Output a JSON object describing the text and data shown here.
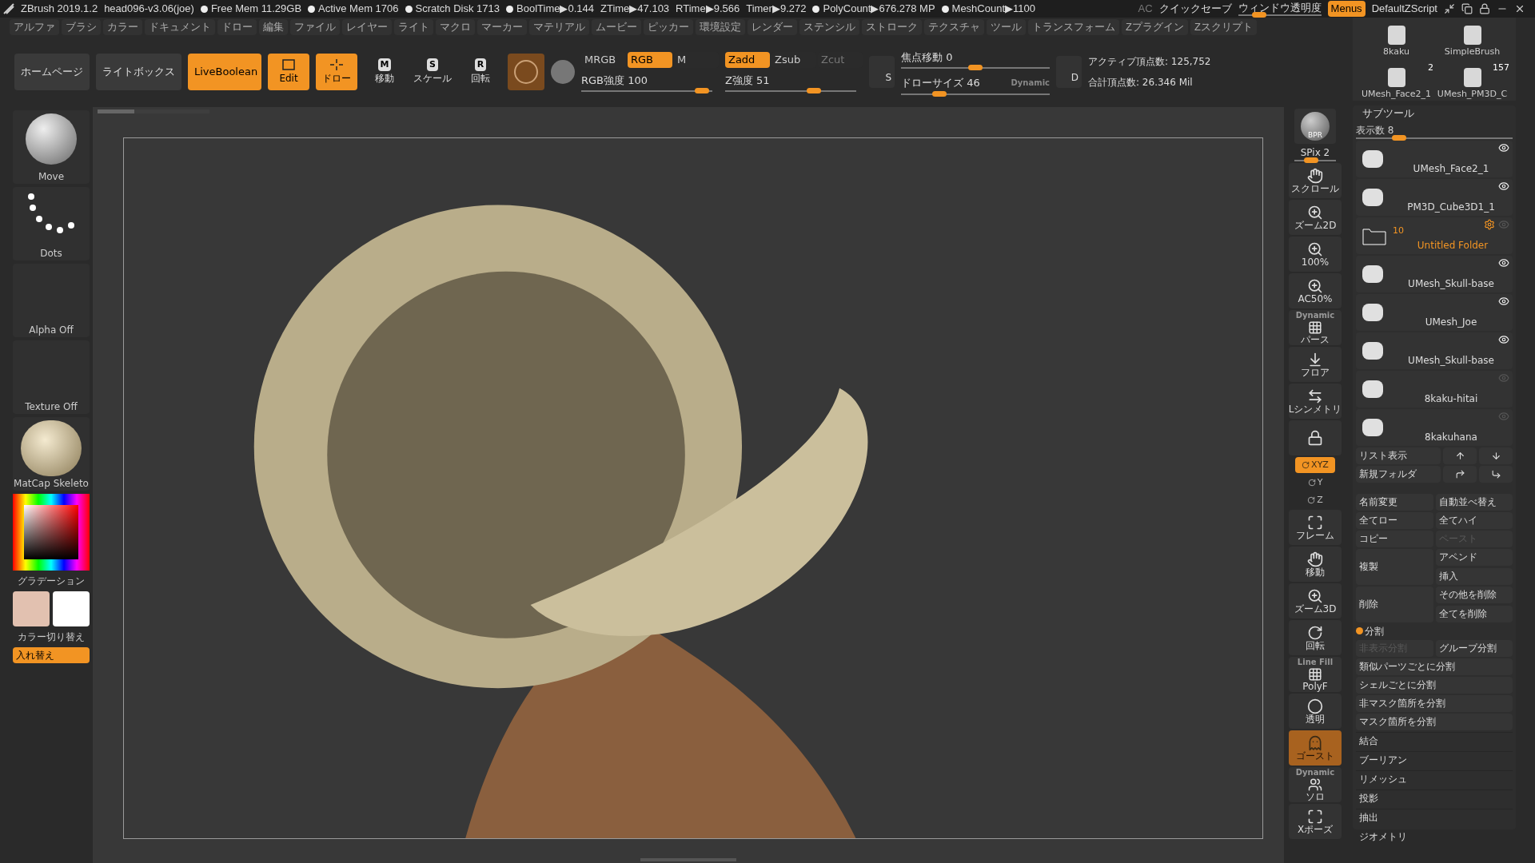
{
  "title_bar": {
    "app": "ZBrush 2019.1.2",
    "file": "head096-v3.06(joe)",
    "stats": [
      {
        "text": "Free Mem 11.29GB",
        "dot": true
      },
      {
        "text": "Active Mem 1706",
        "dot": true
      },
      {
        "text": "Scratch Disk 1713",
        "dot": true
      },
      {
        "text": "BoolTime▶0.144",
        "dot": true
      },
      {
        "text": "ZTime▶47.103",
        "dot": false
      },
      {
        "text": "RTime▶9.566",
        "dot": false
      },
      {
        "text": "Timer▶9.272",
        "dot": false
      },
      {
        "text": "PolyCount▶676.278 MP",
        "dot": true
      },
      {
        "text": "MeshCount▶1100",
        "dot": true
      }
    ],
    "ac": "AC",
    "quicksave": "クイックセーブ",
    "transparency": {
      "label": "ウィンドウ透明度",
      "level": 0.2
    },
    "menus": {
      "label": "Menus",
      "selected": true
    },
    "script": "DefaultZScript"
  },
  "menu": [
    "アルファ",
    "ブラシ",
    "カラー",
    "ドキュメント",
    "ドロー",
    "編集",
    "ファイル",
    "レイヤー",
    "ライト",
    "マクロ",
    "マーカー",
    "マテリアル",
    "ムービー",
    "ピッカー",
    "環境設定",
    "レンダー",
    "ステンシル",
    "ストローク",
    "テクスチャ",
    "ツール",
    "トランスフォーム",
    "Zプラグイン",
    "Zスクリプト"
  ],
  "toolbar": {
    "nav_buttons": [
      {
        "label": "ホームページ",
        "selected": false
      },
      {
        "label": "ライトボックス",
        "selected": false
      },
      {
        "label": "LiveBoolean",
        "selected": true
      }
    ],
    "mode_buttons": [
      {
        "label": "Edit",
        "kind": "edit",
        "selected": true
      },
      {
        "label": "ドロー",
        "kind": "draw",
        "selected": true
      },
      {
        "label": "移動",
        "kind": "key",
        "key": "M",
        "selected": false
      },
      {
        "label": "スケール",
        "kind": "key",
        "key": "S",
        "selected": false
      },
      {
        "label": "回転",
        "kind": "key",
        "key": "R",
        "selected": false
      }
    ],
    "progress": {
      "level": 0.33
    },
    "color_modes": [
      {
        "label": "MRGB",
        "selected": false,
        "disabled": false
      },
      {
        "label": "RGB",
        "selected": true,
        "disabled": false
      },
      {
        "label": "M",
        "selected": false,
        "disabled": false
      }
    ],
    "depth_modes": [
      {
        "label": "Zadd",
        "selected": true,
        "disabled": false
      },
      {
        "label": "Zsub",
        "selected": false,
        "disabled": false
      },
      {
        "label": "Zcut",
        "selected": false,
        "disabled": true
      }
    ],
    "rgb_intensity": {
      "label": "RGB強度 100",
      "level": 0.97
    },
    "z_intensity": {
      "label": "Z強度 51",
      "level": 0.7
    },
    "focal_shift": {
      "label": "焦点移動 0",
      "level": 0.5
    },
    "draw_size": {
      "label": "ドローサイズ 46",
      "level": 0.23,
      "tag": "Dynamic"
    },
    "s_button": "S",
    "d_button": "D",
    "stats": [
      "アクティブ頂点数: 125,752",
      "合計頂点数: 26.346 Mil"
    ]
  },
  "left_panel": {
    "tiles": [
      {
        "label": "Move",
        "kind": "brush"
      },
      {
        "label": "Dots",
        "kind": "stroke"
      },
      {
        "label": "Alpha Off",
        "kind": "alpha"
      },
      {
        "label": "Texture Off",
        "kind": "texture"
      },
      {
        "label": "MatCap Skeleto",
        "kind": "material"
      }
    ],
    "gradient_label": "グラデーション",
    "swatches": [
      {
        "color": "#e2c1b0"
      },
      {
        "color": "#ffffff"
      }
    ],
    "switch_label": "カラー切り替え",
    "swap_button": "入れ替え"
  },
  "right_column": [
    {
      "kind": "bpr",
      "label": "BPR",
      "selected": false
    },
    {
      "kind": "spix",
      "label": "SPix 2",
      "level": 0.35
    },
    {
      "kind": "scroll",
      "label": "スクロール",
      "selected": false
    },
    {
      "kind": "zoom",
      "label": "ズーム2D",
      "selected": false
    },
    {
      "kind": "zoom",
      "label": "100%",
      "selected": false
    },
    {
      "kind": "zoom",
      "label": "AC50%",
      "selected": false
    },
    {
      "kind": "grid",
      "label": "パース",
      "sub": "Dynamic",
      "selected": false
    },
    {
      "kind": "floor",
      "label": "フロア",
      "selected": false
    },
    {
      "kind": "symmetry",
      "label": "Lシンメトリ",
      "selected": false
    },
    {
      "kind": "lock",
      "selected": false
    },
    {
      "kind": "axis",
      "label": "XYZ",
      "selected": true
    },
    {
      "kind": "axis",
      "label": "Y",
      "selected": false
    },
    {
      "kind": "axis",
      "label": "Z",
      "selected": false
    },
    {
      "kind": "frame",
      "label": "フレーム",
      "selected": false
    },
    {
      "kind": "scroll",
      "label": "移動",
      "selected": false
    },
    {
      "kind": "zoom",
      "label": "ズーム3D",
      "selected": false
    },
    {
      "kind": "rotate",
      "label": "回転",
      "selected": false
    },
    {
      "kind": "grid",
      "label": "PolyF",
      "sub": "Line Fill",
      "selected": false
    },
    {
      "kind": "transparent",
      "label": "透明",
      "selected": false
    },
    {
      "kind": "ghost",
      "label": "ゴースト",
      "selected": true
    },
    {
      "kind": "solo",
      "label": "ソロ",
      "sub": "Dynamic",
      "selected": false
    },
    {
      "kind": "frame",
      "label": "Xポーズ",
      "selected": false
    }
  ],
  "shelf": [
    {
      "label": "8kaku"
    },
    {
      "label": "SimpleBrush"
    },
    {
      "label": "UMesh_Face2_1",
      "count": "2"
    },
    {
      "label": "UMesh_PM3D_C",
      "count": "157"
    }
  ],
  "subtool": {
    "title": "サブツール",
    "count": {
      "label": "表示数 8",
      "level": 0.25
    },
    "items": [
      {
        "kind": "subtool",
        "name": "UMesh_Face2_1",
        "visible": true
      },
      {
        "kind": "subtool",
        "name": "PM3D_Cube3D1_1",
        "visible": true
      },
      {
        "kind": "folder",
        "name": "Untitled Folder",
        "count": "10",
        "visible": false
      },
      {
        "kind": "subtool",
        "name": "UMesh_Skull-base",
        "visible": true
      },
      {
        "kind": "subtool",
        "name": "UMesh_Joe",
        "visible": true
      },
      {
        "kind": "subtool",
        "name": "UMesh_Skull-base",
        "visible": true
      },
      {
        "kind": "subtool",
        "name": "8kaku-hitai",
        "visible": false
      },
      {
        "kind": "subtool",
        "name": "8kakuhana",
        "visible": false
      }
    ],
    "list_button": "リスト表示",
    "new_folder": "新規フォルダ",
    "button_rows": [
      [
        {
          "label": "名前変更",
          "disabled": false
        },
        {
          "label": "自動並べ替え",
          "disabled": false
        }
      ],
      [
        {
          "label": "全てロー",
          "disabled": false
        },
        {
          "label": "全てハイ",
          "disabled": false
        }
      ],
      [
        {
          "label": "コピー",
          "disabled": false
        },
        {
          "label": "ペースト",
          "disabled": true
        }
      ]
    ],
    "tall_groups": [
      {
        "label": "複製",
        "items": [
          "アペンド",
          "挿入"
        ]
      },
      {
        "label": "削除",
        "items": [
          "その他を削除",
          "全てを削除"
        ]
      }
    ],
    "split": {
      "title": "分割",
      "pair": [
        {
          "label": "非表示分割",
          "disabled": true
        },
        {
          "label": "グループ分割",
          "disabled": false
        }
      ],
      "wide": [
        "類似パーツごとに分割",
        "シェルごとに分割",
        "非マスク箇所を分割",
        "マスク箇所を分割"
      ]
    },
    "sections": [
      "結合",
      "ブーリアン",
      "リメッシュ",
      "投影",
      "抽出"
    ]
  },
  "tray_next": "ジオメトリ"
}
